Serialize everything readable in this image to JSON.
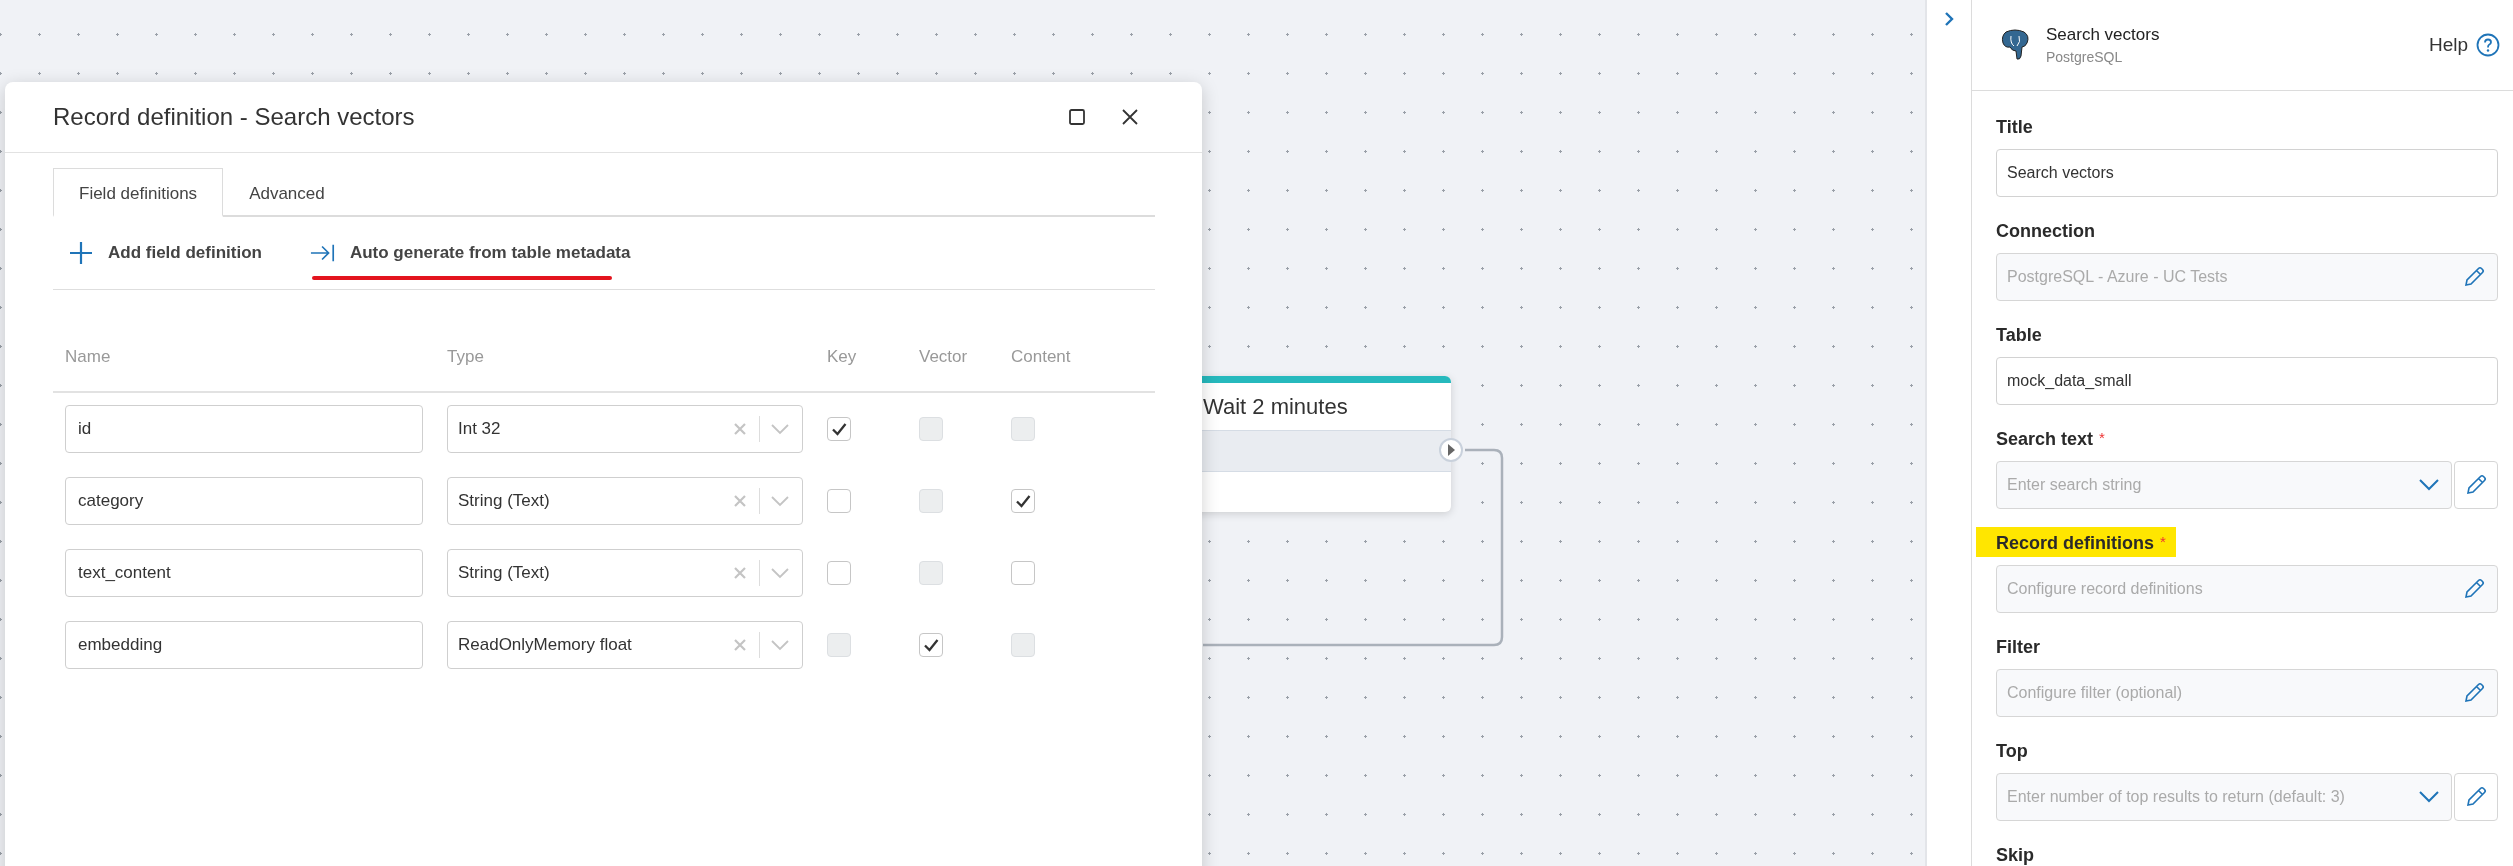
{
  "dialog": {
    "title": "Record definition - Search vectors",
    "tabs": [
      {
        "label": "Field definitions",
        "selected": true
      },
      {
        "label": "Advanced",
        "selected": false
      }
    ],
    "actions": [
      {
        "kind": "add",
        "label": "Add field definition",
        "underlined": false
      },
      {
        "kind": "generate",
        "label": "Auto generate from table metadata",
        "underlined": true
      }
    ],
    "columns": [
      "Name",
      "Type",
      "Key",
      "Vector",
      "Content"
    ],
    "rows": [
      {
        "name": "id",
        "type": "Int 32",
        "key": {
          "checked": true,
          "disabled": false
        },
        "vector": {
          "checked": false,
          "disabled": true
        },
        "content": {
          "checked": false,
          "disabled": true
        }
      },
      {
        "name": "category",
        "type": "String (Text)",
        "key": {
          "checked": false,
          "disabled": false
        },
        "vector": {
          "checked": false,
          "disabled": true
        },
        "content": {
          "checked": true,
          "disabled": false
        }
      },
      {
        "name": "text_content",
        "type": "String (Text)",
        "key": {
          "checked": false,
          "disabled": false
        },
        "vector": {
          "checked": false,
          "disabled": true
        },
        "content": {
          "checked": false,
          "disabled": false
        }
      },
      {
        "name": "embedding",
        "type": "ReadOnlyMemory float",
        "key": {
          "checked": false,
          "disabled": true
        },
        "vector": {
          "checked": true,
          "disabled": false
        },
        "content": {
          "checked": false,
          "disabled": true
        }
      }
    ]
  },
  "canvas": {
    "node": {
      "title": "Wait 2 minutes"
    }
  },
  "panel": {
    "title": "Search vectors",
    "subtitle": "PostgreSQL",
    "help": "Help",
    "fields": [
      {
        "label": "Title",
        "kind": "text",
        "value": "Search vectors",
        "highlighted": false
      },
      {
        "label": "Connection",
        "kind": "edit",
        "placeholder": "PostgreSQL - Azure - UC Tests",
        "highlighted": false
      },
      {
        "label": "Table",
        "kind": "text",
        "value": "mock_data_small",
        "highlighted": false
      },
      {
        "label": "Search text",
        "marker": "*",
        "kind": "select",
        "placeholder": "Enter search string",
        "highlighted": false
      },
      {
        "label": "Record definitions",
        "marker": "*",
        "kind": "edit",
        "placeholder": "Configure record definitions",
        "highlighted": true
      },
      {
        "label": "Filter",
        "kind": "edit",
        "placeholder": "Configure filter (optional)",
        "highlighted": false
      },
      {
        "label": "Top",
        "kind": "select",
        "placeholder": "Enter number of top results to return (default: 3)",
        "highlighted": false
      },
      {
        "label": "Skip",
        "highlighted": false
      }
    ]
  }
}
